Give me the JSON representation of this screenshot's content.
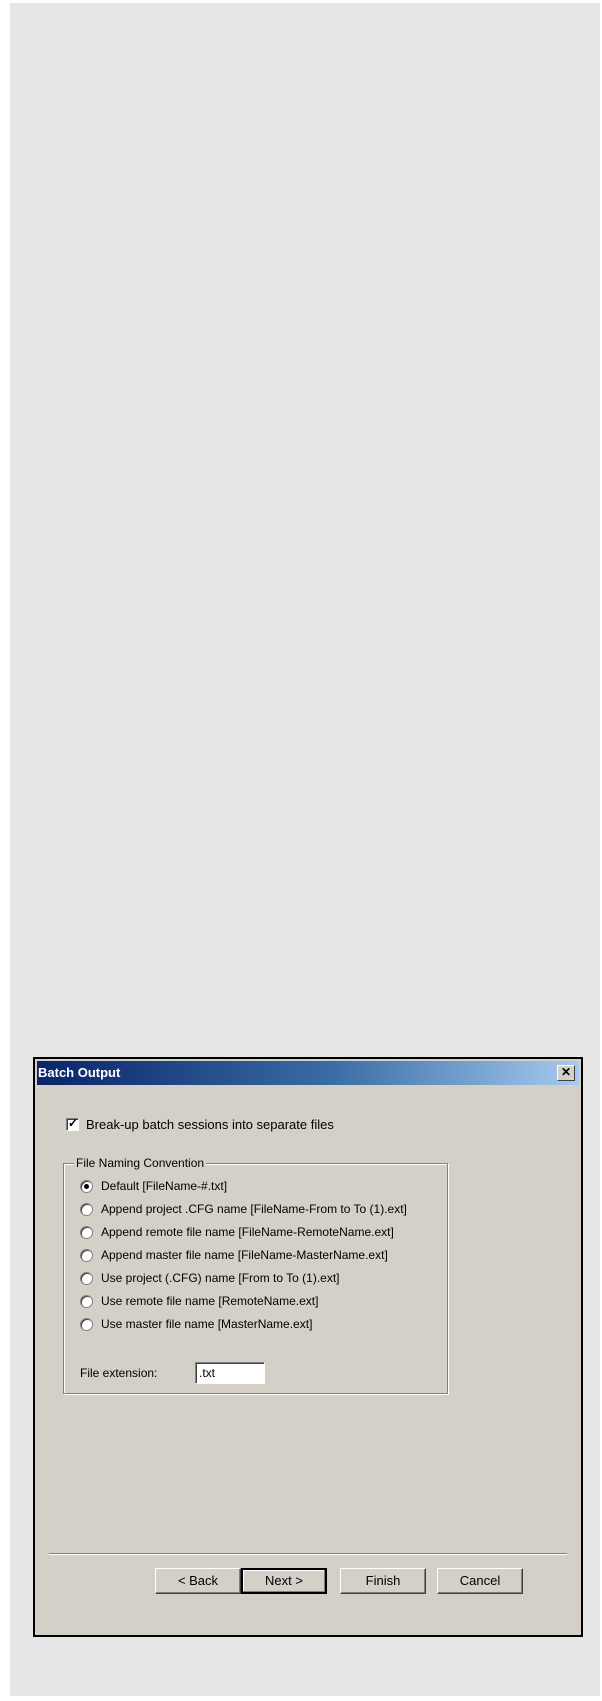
{
  "dialog": {
    "title": "Batch Output",
    "close_glyph": "✕"
  },
  "checkbox": {
    "label": "Break-up batch sessions into separate files",
    "checked": true
  },
  "group": {
    "legend": "File Naming Convention",
    "options": [
      {
        "label": "Default [FileName-#.txt]",
        "selected": true
      },
      {
        "label": "Append project .CFG name [FileName-From to To (1).ext]",
        "selected": false
      },
      {
        "label": "Append remote file name [FileName-RemoteName.ext]",
        "selected": false
      },
      {
        "label": "Append master file name [FileName-MasterName.ext]",
        "selected": false
      },
      {
        "label": "Use project (.CFG) name [From to To (1).ext]",
        "selected": false
      },
      {
        "label": "Use remote file name [RemoteName.ext]",
        "selected": false
      },
      {
        "label": "Use master file name [MasterName.ext]",
        "selected": false
      }
    ],
    "extension_label": "File extension:",
    "extension_value": ".txt"
  },
  "buttons": {
    "back": "< Back",
    "next": "Next >",
    "finish": "Finish",
    "cancel": "Cancel"
  }
}
